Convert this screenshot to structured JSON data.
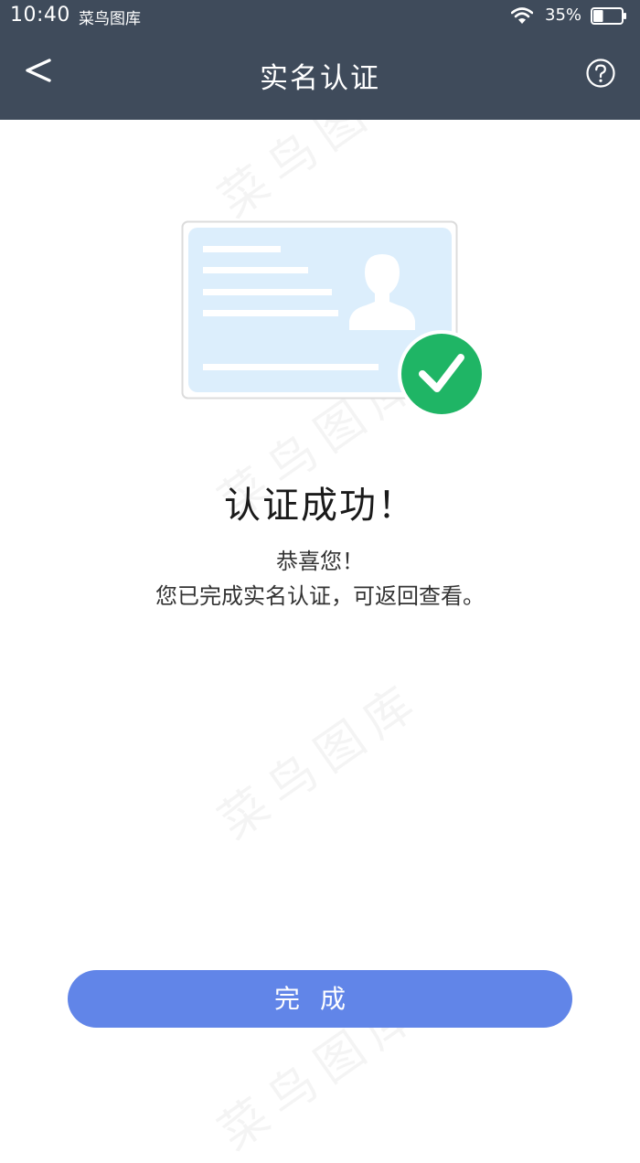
{
  "status_bar": {
    "time": "10:40",
    "app_name": "菜鸟图库",
    "battery_percent": "35%",
    "battery_level": 0.35
  },
  "nav": {
    "back_icon": "chevron-left-icon",
    "title": "实名认证",
    "help_icon": "question-circle-icon"
  },
  "illustration": {
    "card_icon": "id-card-icon",
    "check_icon": "checkmark-circle-icon"
  },
  "result": {
    "title": "认证成功！",
    "line1": "恭喜您！",
    "line2": "您已完成实名认证，可返回查看。"
  },
  "actions": {
    "done_label": "完成"
  },
  "watermark": {
    "text": "菜鸟图库"
  },
  "colors": {
    "header_bg": "#3f4b5b",
    "card_bg": "#dceefc",
    "card_line": "#ffffff",
    "check_green": "#1fb565",
    "button_blue": "#6185e8",
    "title_text": "#1a1a1a",
    "body_text": "#333333"
  }
}
